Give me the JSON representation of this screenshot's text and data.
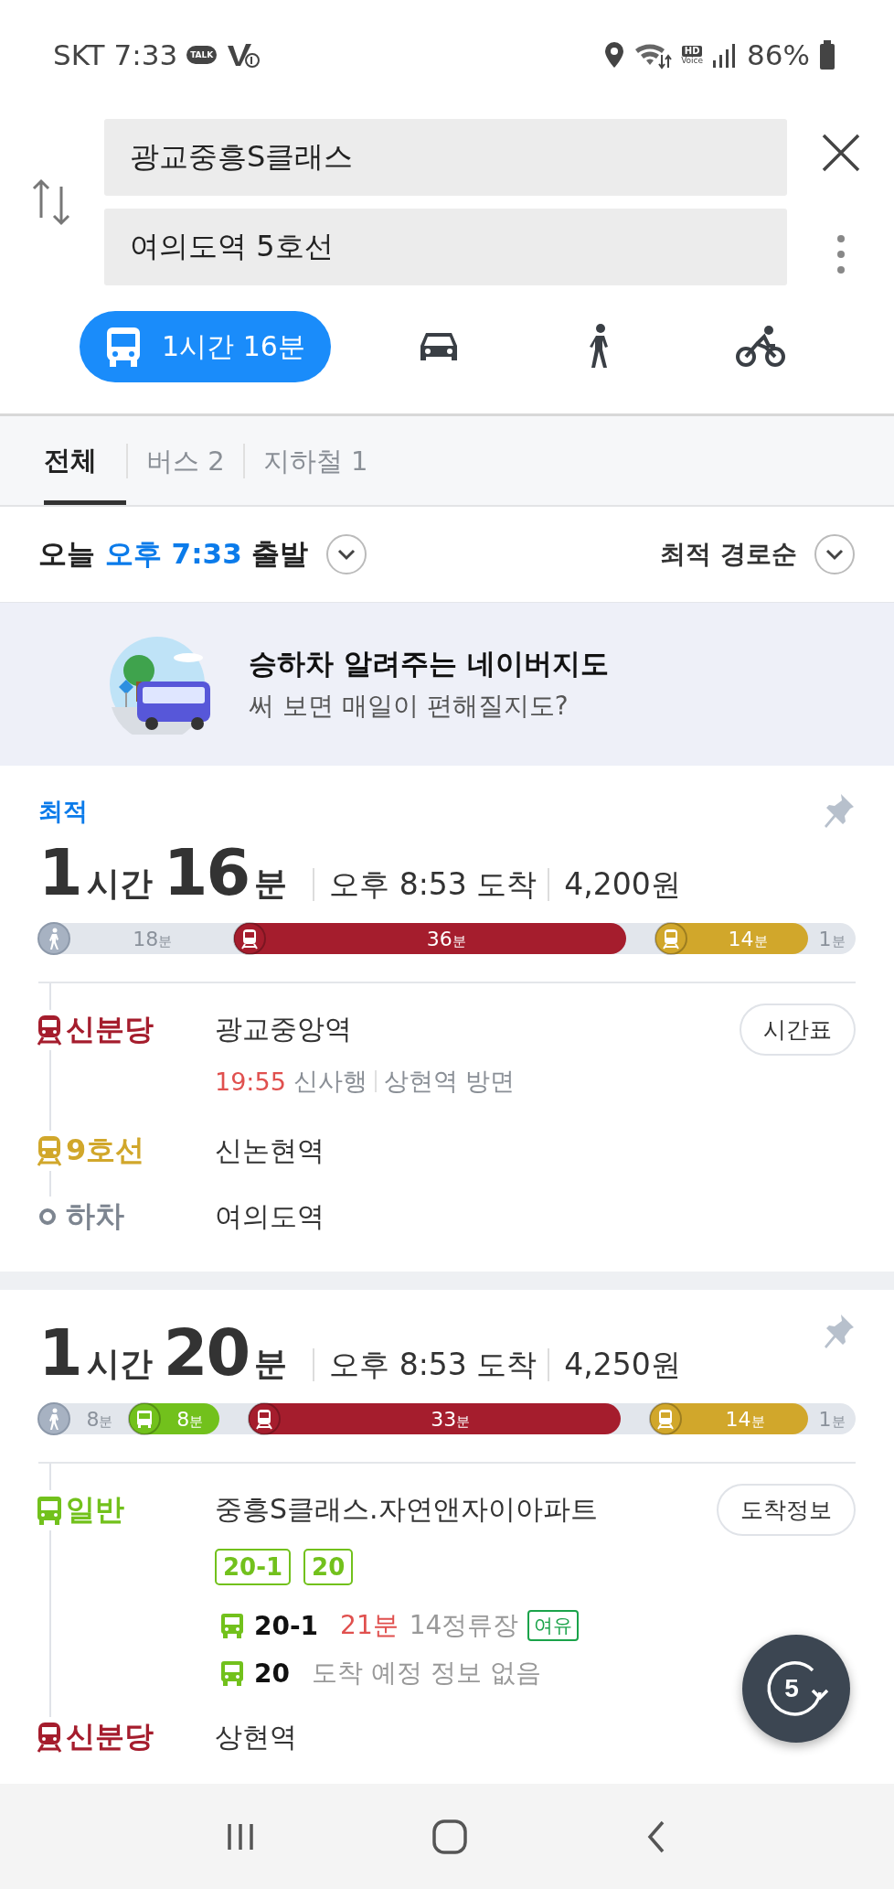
{
  "status_bar": {
    "carrier": "SKT",
    "time": "7:33",
    "talk": "TALK",
    "hd": "HD",
    "voice": "Voice",
    "battery": "86%"
  },
  "search": {
    "origin": "광교중흥S클래스",
    "destination": "여의도역 5호선"
  },
  "modes": [
    {
      "kind": "bus",
      "label": "1시간 16분",
      "selected": true
    },
    {
      "kind": "car",
      "selected": false
    },
    {
      "kind": "walk",
      "selected": false
    },
    {
      "kind": "bike",
      "selected": false
    }
  ],
  "tabs": [
    {
      "label": "전체",
      "selected": true
    },
    {
      "label": "버스 2",
      "selected": false
    },
    {
      "label": "지하철 1",
      "selected": false
    }
  ],
  "departure": {
    "day": "오늘",
    "time": "오후 7:33",
    "suffix": "출발",
    "sort": "최적 경로순"
  },
  "banner": {
    "title": "승하차 알려주는 네이버지도",
    "subtitle": "써 보면 매일이 편해질지도?"
  },
  "routes": [
    {
      "tag": "최적",
      "duration": [
        {
          "num": "1",
          "unit": "시간"
        },
        {
          "num": "16",
          "unit": "분"
        }
      ],
      "arrival": "오후 8:53 도착",
      "fare": "4,200원",
      "segments": [
        {
          "kind": "walk",
          "value": "18",
          "unit": "분"
        },
        {
          "kind": "subway",
          "color": "#a51d2d",
          "value": "36",
          "unit": "분"
        },
        {
          "kind": "walk"
        },
        {
          "kind": "subway",
          "color": "#d1a72b",
          "value": "14",
          "unit": "분"
        },
        {
          "kind": "walk",
          "value": "1",
          "unit": "분"
        }
      ],
      "steps": [
        {
          "kind": "subway",
          "color": "#a51d2d",
          "line": "신분당",
          "station": "광교중앙역",
          "button": "시간표",
          "detail": {
            "time": "19:55",
            "dest": "신사행",
            "dir": "상현역 방면"
          }
        },
        {
          "kind": "subway",
          "color": "#d1a72b",
          "line": "9호선",
          "station": "신논현역"
        },
        {
          "kind": "alight",
          "line": "하차",
          "station": "여의도역"
        }
      ]
    },
    {
      "duration": [
        {
          "num": "1",
          "unit": "시간"
        },
        {
          "num": "20",
          "unit": "분"
        }
      ],
      "arrival": "오후 8:53 도착",
      "fare": "4,250원",
      "segments": [
        {
          "kind": "walk",
          "value": "8",
          "unit": "분"
        },
        {
          "kind": "bus",
          "color": "#72c11c",
          "value": "8",
          "unit": "분"
        },
        {
          "kind": "walk"
        },
        {
          "kind": "subway",
          "color": "#a51d2d",
          "value": "33",
          "unit": "분"
        },
        {
          "kind": "walk"
        },
        {
          "kind": "subway",
          "color": "#d1a72b",
          "value": "14",
          "unit": "분"
        },
        {
          "kind": "walk",
          "value": "1",
          "unit": "분"
        }
      ],
      "steps": [
        {
          "kind": "bus",
          "color": "#72c11c",
          "line": "일반",
          "station": "중흥S클래스.자연앤자이아파트",
          "button": "도착정보",
          "badges": [
            "20-1",
            "20"
          ],
          "arrivals": [
            {
              "bus": "20-1",
              "minutes": "21분",
              "stops": "14정류장",
              "status": "여유"
            },
            {
              "bus": "20",
              "info": "도착 예정 정보 없음"
            }
          ]
        },
        {
          "kind": "subway",
          "color": "#a51d2d",
          "line": "신분당",
          "station": "상현역"
        }
      ]
    }
  ],
  "refresh": {
    "count": "5"
  }
}
